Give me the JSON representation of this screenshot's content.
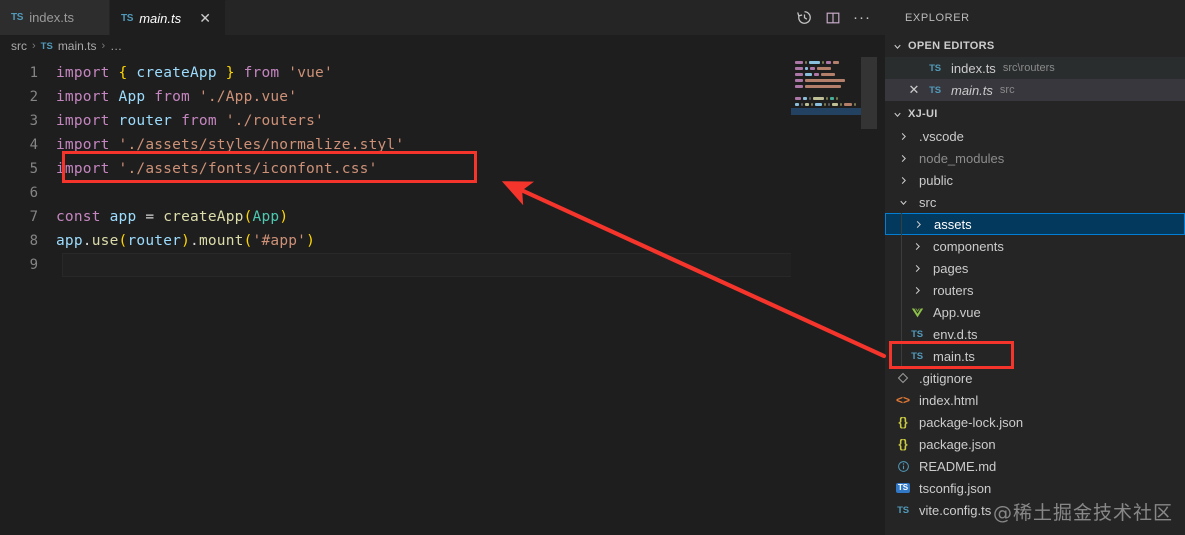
{
  "window": {
    "title": "Visual Studio Code"
  },
  "tabs": [
    {
      "icon": "ts-icon",
      "label": "index.ts",
      "active": false,
      "closable": false
    },
    {
      "icon": "ts-icon",
      "label": "main.ts",
      "active": true,
      "closable": true,
      "close_glyph": "✕"
    }
  ],
  "tab_actions": [
    {
      "name": "timeline-history-icon",
      "tooltip": "Timeline"
    },
    {
      "name": "split-editor-icon",
      "tooltip": "Split Editor"
    },
    {
      "name": "more-actions-icon",
      "tooltip": "More Actions...",
      "glyph": "···"
    }
  ],
  "breadcrumb": {
    "root": "src",
    "file_icon": "TS",
    "file": "main.ts",
    "more": "…",
    "separator": "›"
  },
  "editor": {
    "language": "typescript",
    "current_line": 9,
    "lines": [
      {
        "n": 1,
        "tokens": [
          {
            "t": "import",
            "c": "kw"
          },
          {
            "t": " ",
            "c": "pun"
          },
          {
            "t": "{",
            "c": "brc"
          },
          {
            "t": " ",
            "c": "pun"
          },
          {
            "t": "createApp",
            "c": "id"
          },
          {
            "t": " ",
            "c": "pun"
          },
          {
            "t": "}",
            "c": "brc"
          },
          {
            "t": " ",
            "c": "pun"
          },
          {
            "t": "from",
            "c": "kw"
          },
          {
            "t": " ",
            "c": "pun"
          },
          {
            "t": "'vue'",
            "c": "str"
          }
        ]
      },
      {
        "n": 2,
        "tokens": [
          {
            "t": "import",
            "c": "kw"
          },
          {
            "t": " ",
            "c": "pun"
          },
          {
            "t": "App",
            "c": "id"
          },
          {
            "t": " ",
            "c": "pun"
          },
          {
            "t": "from",
            "c": "kw"
          },
          {
            "t": " ",
            "c": "pun"
          },
          {
            "t": "'./App.vue'",
            "c": "str"
          }
        ]
      },
      {
        "n": 3,
        "tokens": [
          {
            "t": "import",
            "c": "kw"
          },
          {
            "t": " ",
            "c": "pun"
          },
          {
            "t": "router",
            "c": "id"
          },
          {
            "t": " ",
            "c": "pun"
          },
          {
            "t": "from",
            "c": "kw"
          },
          {
            "t": " ",
            "c": "pun"
          },
          {
            "t": "'./routers'",
            "c": "str"
          }
        ]
      },
      {
        "n": 4,
        "tokens": [
          {
            "t": "import",
            "c": "kw"
          },
          {
            "t": " ",
            "c": "pun"
          },
          {
            "t": "'./assets/styles/normalize.styl'",
            "c": "str"
          }
        ]
      },
      {
        "n": 5,
        "tokens": [
          {
            "t": "import",
            "c": "kw"
          },
          {
            "t": " ",
            "c": "pun"
          },
          {
            "t": "'./assets/fonts/iconfont.css'",
            "c": "str"
          }
        ]
      },
      {
        "n": 6,
        "tokens": []
      },
      {
        "n": 7,
        "tokens": [
          {
            "t": "const",
            "c": "kw"
          },
          {
            "t": " ",
            "c": "pun"
          },
          {
            "t": "app",
            "c": "id"
          },
          {
            "t": " ",
            "c": "pun"
          },
          {
            "t": "=",
            "c": "pun"
          },
          {
            "t": " ",
            "c": "pun"
          },
          {
            "t": "createApp",
            "c": "fn"
          },
          {
            "t": "(",
            "c": "brc"
          },
          {
            "t": "App",
            "c": "cls"
          },
          {
            "t": ")",
            "c": "brc"
          }
        ]
      },
      {
        "n": 8,
        "tokens": [
          {
            "t": "app",
            "c": "id"
          },
          {
            "t": ".",
            "c": "pun"
          },
          {
            "t": "use",
            "c": "fn"
          },
          {
            "t": "(",
            "c": "brc"
          },
          {
            "t": "router",
            "c": "id"
          },
          {
            "t": ")",
            "c": "brc"
          },
          {
            "t": ".",
            "c": "pun"
          },
          {
            "t": "mount",
            "c": "fn"
          },
          {
            "t": "(",
            "c": "brc"
          },
          {
            "t": "'#app'",
            "c": "str"
          },
          {
            "t": ")",
            "c": "brc"
          }
        ]
      },
      {
        "n": 9,
        "tokens": []
      }
    ]
  },
  "sidebar": {
    "title": "EXPLORER",
    "open_editors": {
      "label": "OPEN EDITORS",
      "expanded": true,
      "chevron": "⌄",
      "items": [
        {
          "icon": "ts-icon",
          "name": "index.ts",
          "path": "src\\routers",
          "active": false,
          "italic": false,
          "close_glyph": ""
        },
        {
          "icon": "ts-icon",
          "name": "main.ts",
          "path": "src",
          "active": true,
          "italic": true,
          "close_glyph": "✕"
        }
      ]
    },
    "project": {
      "label": "XJ-UI",
      "expanded": true,
      "chevron": "⌄",
      "tree": [
        {
          "kind": "folder",
          "name": ".vscode",
          "indent": 1,
          "expanded": false,
          "dim": false
        },
        {
          "kind": "folder",
          "name": "node_modules",
          "indent": 1,
          "expanded": false,
          "dim": true
        },
        {
          "kind": "folder",
          "name": "public",
          "indent": 1,
          "expanded": false,
          "dim": false
        },
        {
          "kind": "folder",
          "name": "src",
          "indent": 1,
          "expanded": true,
          "dim": false
        },
        {
          "kind": "folder",
          "name": "assets",
          "indent": 2,
          "expanded": false,
          "dim": false,
          "selected": true
        },
        {
          "kind": "folder",
          "name": "components",
          "indent": 2,
          "expanded": false,
          "dim": false
        },
        {
          "kind": "folder",
          "name": "pages",
          "indent": 2,
          "expanded": false,
          "dim": false
        },
        {
          "kind": "folder",
          "name": "routers",
          "indent": 2,
          "expanded": false,
          "dim": false
        },
        {
          "kind": "file",
          "icon": "vue-icon",
          "name": "App.vue",
          "indent": 2
        },
        {
          "kind": "file",
          "icon": "ts-icon",
          "name": "env.d.ts",
          "indent": 2
        },
        {
          "kind": "file",
          "icon": "ts-icon",
          "name": "main.ts",
          "indent": 2,
          "annotated": true
        },
        {
          "kind": "file",
          "icon": "git-icon",
          "name": ".gitignore",
          "indent": 1
        },
        {
          "kind": "file",
          "icon": "html-icon",
          "name": "index.html",
          "indent": 1
        },
        {
          "kind": "file",
          "icon": "json-icon",
          "name": "package-lock.json",
          "indent": 1
        },
        {
          "kind": "file",
          "icon": "json-icon",
          "name": "package.json",
          "indent": 1
        },
        {
          "kind": "file",
          "icon": "md-icon",
          "name": "README.md",
          "indent": 1
        },
        {
          "kind": "file",
          "icon": "tsjson-icon",
          "name": "tsconfig.json",
          "indent": 1
        },
        {
          "kind": "file",
          "icon": "ts-icon",
          "name": "vite.config.ts",
          "indent": 1
        }
      ]
    }
  },
  "annotations": {
    "code_box": {
      "label": "highlight-import-iconfont"
    },
    "file_box": {
      "label": "highlight-main-ts-file"
    },
    "arrow": {
      "label": "arrow-from-file-to-code"
    },
    "color": "#f5352c"
  },
  "watermark": {
    "text": "@稀土掘金技术社区"
  },
  "colors": {
    "editor_bg": "#1e1e1e",
    "sidebar_bg": "#252526",
    "tab_inactive_bg": "#2d2d2d",
    "selection_blue": "#04395e",
    "focus_border": "#007fd4",
    "annotation_red": "#f5352c"
  }
}
